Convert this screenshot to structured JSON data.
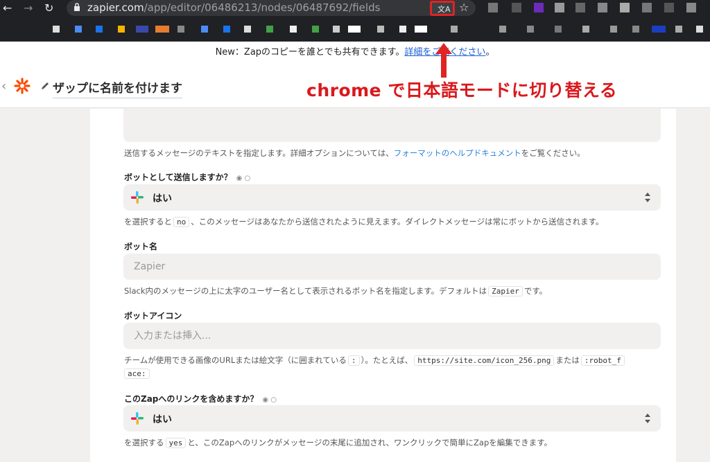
{
  "browser": {
    "url_host": "zapier.com",
    "url_path": "/app/editor/06486213/nodes/06487692/fields"
  },
  "banner": {
    "text": "New：Zapのコピーを誰とでも共有できます。",
    "link": "詳細をご覧ください",
    "suffix": "。"
  },
  "header": {
    "zap_title": "ザップに名前を付けます"
  },
  "callout": {
    "text": "chrome で日本語モードに切り替える"
  },
  "form": {
    "message_help_pre": "送信するメッセージのテキストを指定します。詳細オプションについては、",
    "message_help_link": "フォーマットのヘルプドキュメント",
    "message_help_post": "をご覧ください。",
    "bot_send": {
      "label": "ボットとして送信しますか？",
      "value": "はい",
      "help_pre": "を選択すると",
      "help_code": "no",
      "help_post": "、このメッセージはあなたから送信されたように見えます。ダイレクトメッセージは常にボットから送信されます。"
    },
    "bot_name": {
      "label": "ボット名",
      "placeholder": "Zapier",
      "help_pre": "Slack内のメッセージの上に太字のユーザー名として表示されるボット名を指定します。デフォルトは",
      "help_code": "Zapier",
      "help_post": "です。"
    },
    "bot_icon": {
      "label": "ボットアイコン",
      "placeholder": "入力または挿入...",
      "help_pre": "チームが使用できる画像のURLまたは絵文字（に囲まれている",
      "help_code1": ":",
      "help_mid1": "）。たとえば、",
      "help_code2": "https://site.com/icon_256.png",
      "help_mid2": "または",
      "help_code3": ":robot_f",
      "help_line2_code": "ace:"
    },
    "zap_link": {
      "label": "このZapへのリンクを含めますか？",
      "value": "はい",
      "help_pre": "を選択する",
      "help_code": "yes",
      "help_post": "と、このZapへのリンクがメッセージの末尾に追加され、ワンクリックで簡単にZapを編集できます。"
    }
  },
  "colors": {
    "zapier_orange": "#ff4a00",
    "callout_red": "#d9191c",
    "link_blue": "#2a7fe0"
  }
}
